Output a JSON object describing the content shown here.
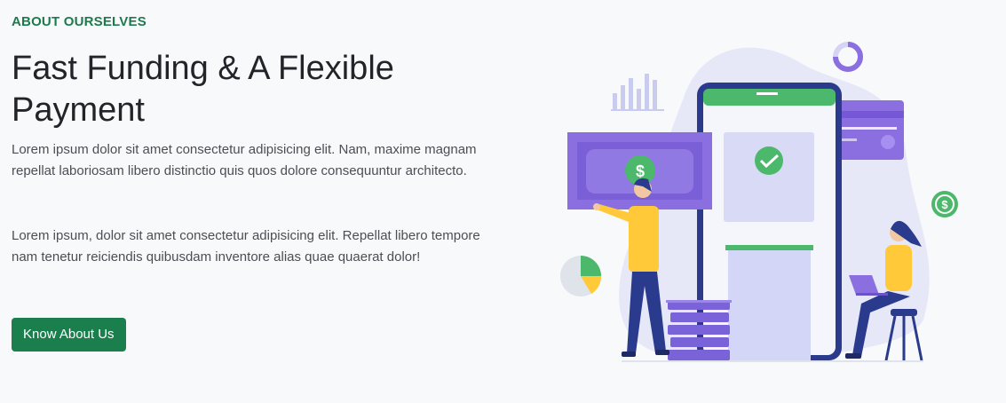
{
  "section": {
    "eyebrow": "ABOUT OURSELVES",
    "title": "Fast Funding & A Flexible Payment",
    "paragraphs": [
      "Lorem ipsum dolor sit amet consectetur adipisicing elit. Nam, maxime magnam repellat laboriosam libero distinctio quis quos dolore consequuntur architecto.",
      "Lorem ipsum, dolor sit amet consectetur adipisicing elit. Repellat libero tempore nam tenetur reiciendis quibusdam inventore alias quae quaerat dolor!"
    ],
    "cta_label": "Know About Us"
  },
  "illustration": {
    "money_symbol": "$"
  },
  "colors": {
    "accent": "#1b7f4d",
    "purple": "#8b6ee0",
    "yellow": "#ffc93a",
    "navy": "#2a3a8c",
    "green": "#4cb86b"
  }
}
